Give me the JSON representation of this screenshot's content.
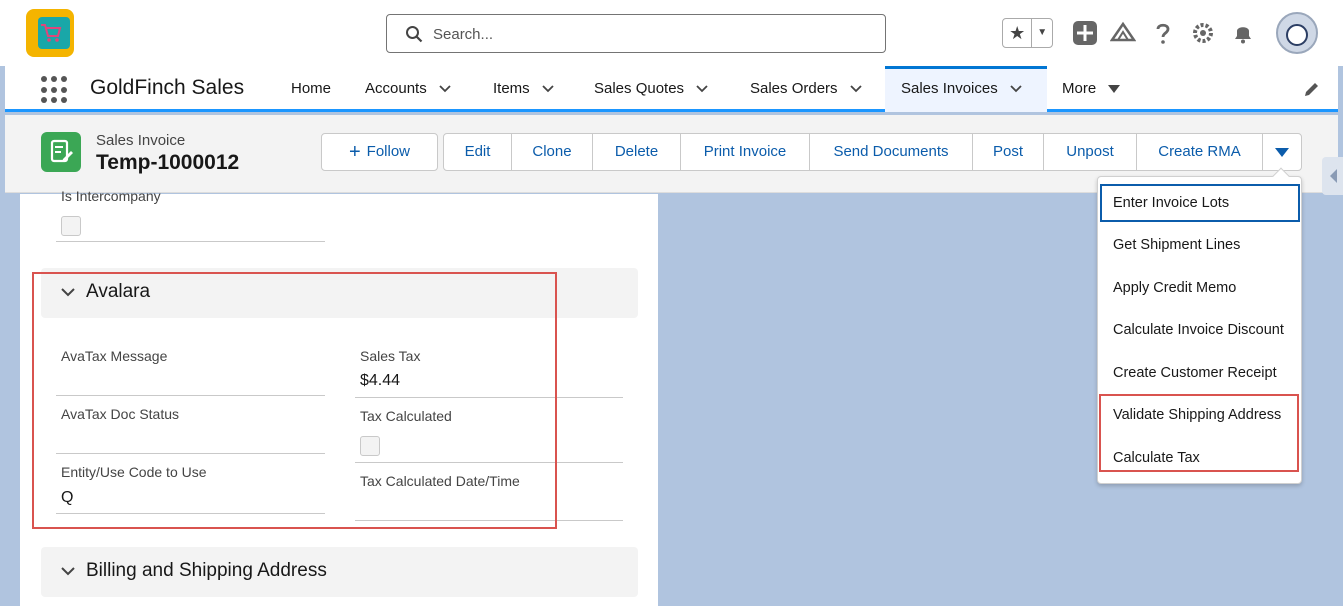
{
  "header": {
    "logo_text": "GoldFinch",
    "search_placeholder": "Search...",
    "icons": [
      "star-icon",
      "chevron-down-icon",
      "plus-icon",
      "trailhead-icon",
      "help-icon",
      "gear-icon",
      "bell-icon",
      "avatar"
    ]
  },
  "nav": {
    "app_name": "GoldFinch Sales",
    "items": [
      {
        "label": "Home"
      },
      {
        "label": "Accounts"
      },
      {
        "label": "Items"
      },
      {
        "label": "Sales Quotes"
      },
      {
        "label": "Sales Orders"
      },
      {
        "label": "Sales Invoices",
        "active": true
      },
      {
        "label": "More"
      }
    ]
  },
  "record": {
    "object_label": "Sales Invoice",
    "title": "Temp-1000012",
    "actions": {
      "follow": "Follow",
      "edit": "Edit",
      "clone": "Clone",
      "delete": "Delete",
      "print_invoice": "Print Invoice",
      "send_documents": "Send Documents",
      "post": "Post",
      "unpost": "Unpost",
      "create_rma": "Create RMA"
    }
  },
  "detail": {
    "is_intercompany_label": "Is Intercompany",
    "avalara": {
      "title": "Avalara",
      "avatax_message_label": "AvaTax Message",
      "avatax_doc_status_label": "AvaTax Doc Status",
      "entity_use_code_label": "Entity/Use Code to Use",
      "entity_use_code_value": "Q",
      "sales_tax_label": "Sales Tax",
      "sales_tax_value": "$4.44",
      "tax_calculated_label": "Tax Calculated",
      "tax_calculated_datetime_label": "Tax Calculated Date/Time"
    },
    "billing_section_title": "Billing and Shipping Address"
  },
  "menu": {
    "items": [
      {
        "label": "Enter Invoice Lots"
      },
      {
        "label": "Get Shipment Lines"
      },
      {
        "label": "Apply Credit Memo"
      },
      {
        "label": "Calculate Invoice Discount"
      },
      {
        "label": "Create Customer Receipt"
      },
      {
        "label": "Validate Shipping Address"
      },
      {
        "label": "Calculate Tax"
      }
    ]
  },
  "colors": {
    "brand_blue": "#0176d3",
    "link_blue": "#0b5cab",
    "highlight_red": "#d9534f",
    "record_icon_green": "#3ba755"
  }
}
